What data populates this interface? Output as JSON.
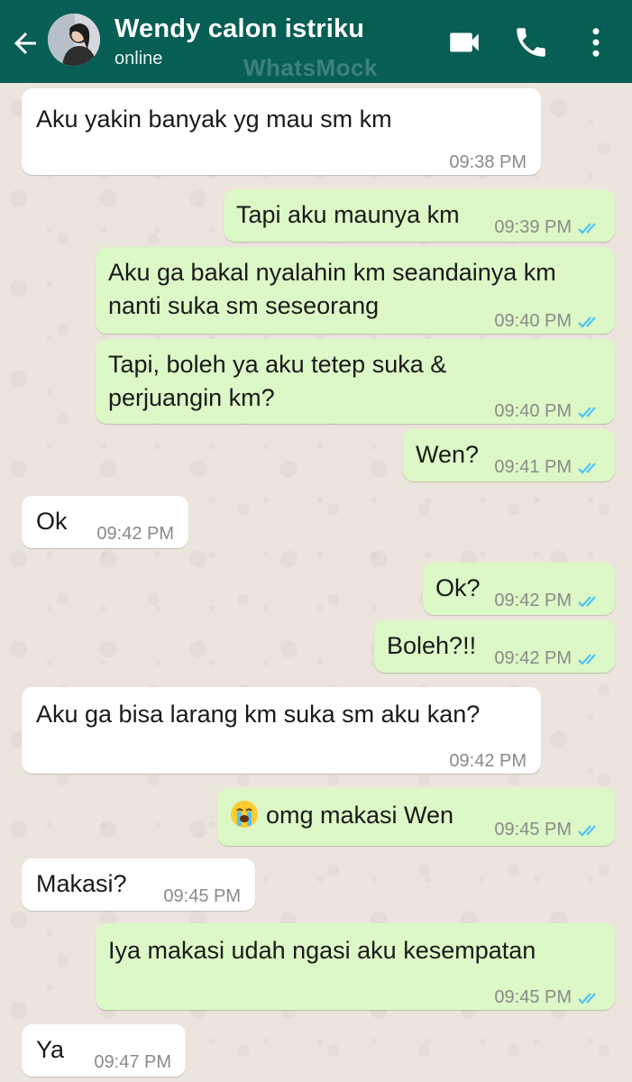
{
  "header": {
    "contact_name": "Wendy calon istriku",
    "status": "online",
    "watermark": "WhatsMock",
    "icons": [
      "back-arrow-icon",
      "avatar",
      "video-call-icon",
      "phone-icon",
      "more-vert-icon"
    ]
  },
  "colors": {
    "header": "#075e54",
    "incoming_bubble": "#ffffff",
    "outgoing_bubble": "#dcf8c6",
    "read_tick": "#4fc3f7",
    "wallpaper": "#ece5dd"
  },
  "messages": [
    {
      "dir": "in",
      "text": "Aku yakin banyak yg mau sm km",
      "time": "09:38 PM"
    },
    {
      "dir": "out",
      "text": "Tapi aku maunya km",
      "time": "09:39 PM",
      "read": true
    },
    {
      "dir": "out",
      "text": "Aku ga bakal nyalahin km seandainya km",
      "text2": "nanti suka sm seseorang",
      "time": "09:40 PM",
      "read": true
    },
    {
      "dir": "out",
      "text": "Tapi, boleh ya aku tetep suka &",
      "text2": "perjuangin km?",
      "time": "09:40 PM",
      "read": true
    },
    {
      "dir": "out",
      "text": "Wen?",
      "time": "09:41 PM",
      "read": true
    },
    {
      "dir": "in",
      "text": "Ok",
      "time": "09:42 PM"
    },
    {
      "dir": "out",
      "text": "Ok?",
      "time": "09:42 PM",
      "read": true
    },
    {
      "dir": "out",
      "text": "Boleh?!!",
      "time": "09:42 PM",
      "read": true
    },
    {
      "dir": "in",
      "text": "Aku ga bisa larang km suka sm aku kan?",
      "time": "09:42 PM"
    },
    {
      "dir": "out",
      "text": "omg makasi Wen",
      "emoji": "loudly-crying-face-emoji",
      "time": "09:45 PM",
      "read": true
    },
    {
      "dir": "in",
      "text": "Makasi?",
      "time": "09:45 PM"
    },
    {
      "dir": "out",
      "text": "Iya makasi udah ngasi aku kesempatan",
      "time": "09:45 PM",
      "read": true
    },
    {
      "dir": "in",
      "text": "Ya",
      "time": "09:47 PM"
    }
  ]
}
